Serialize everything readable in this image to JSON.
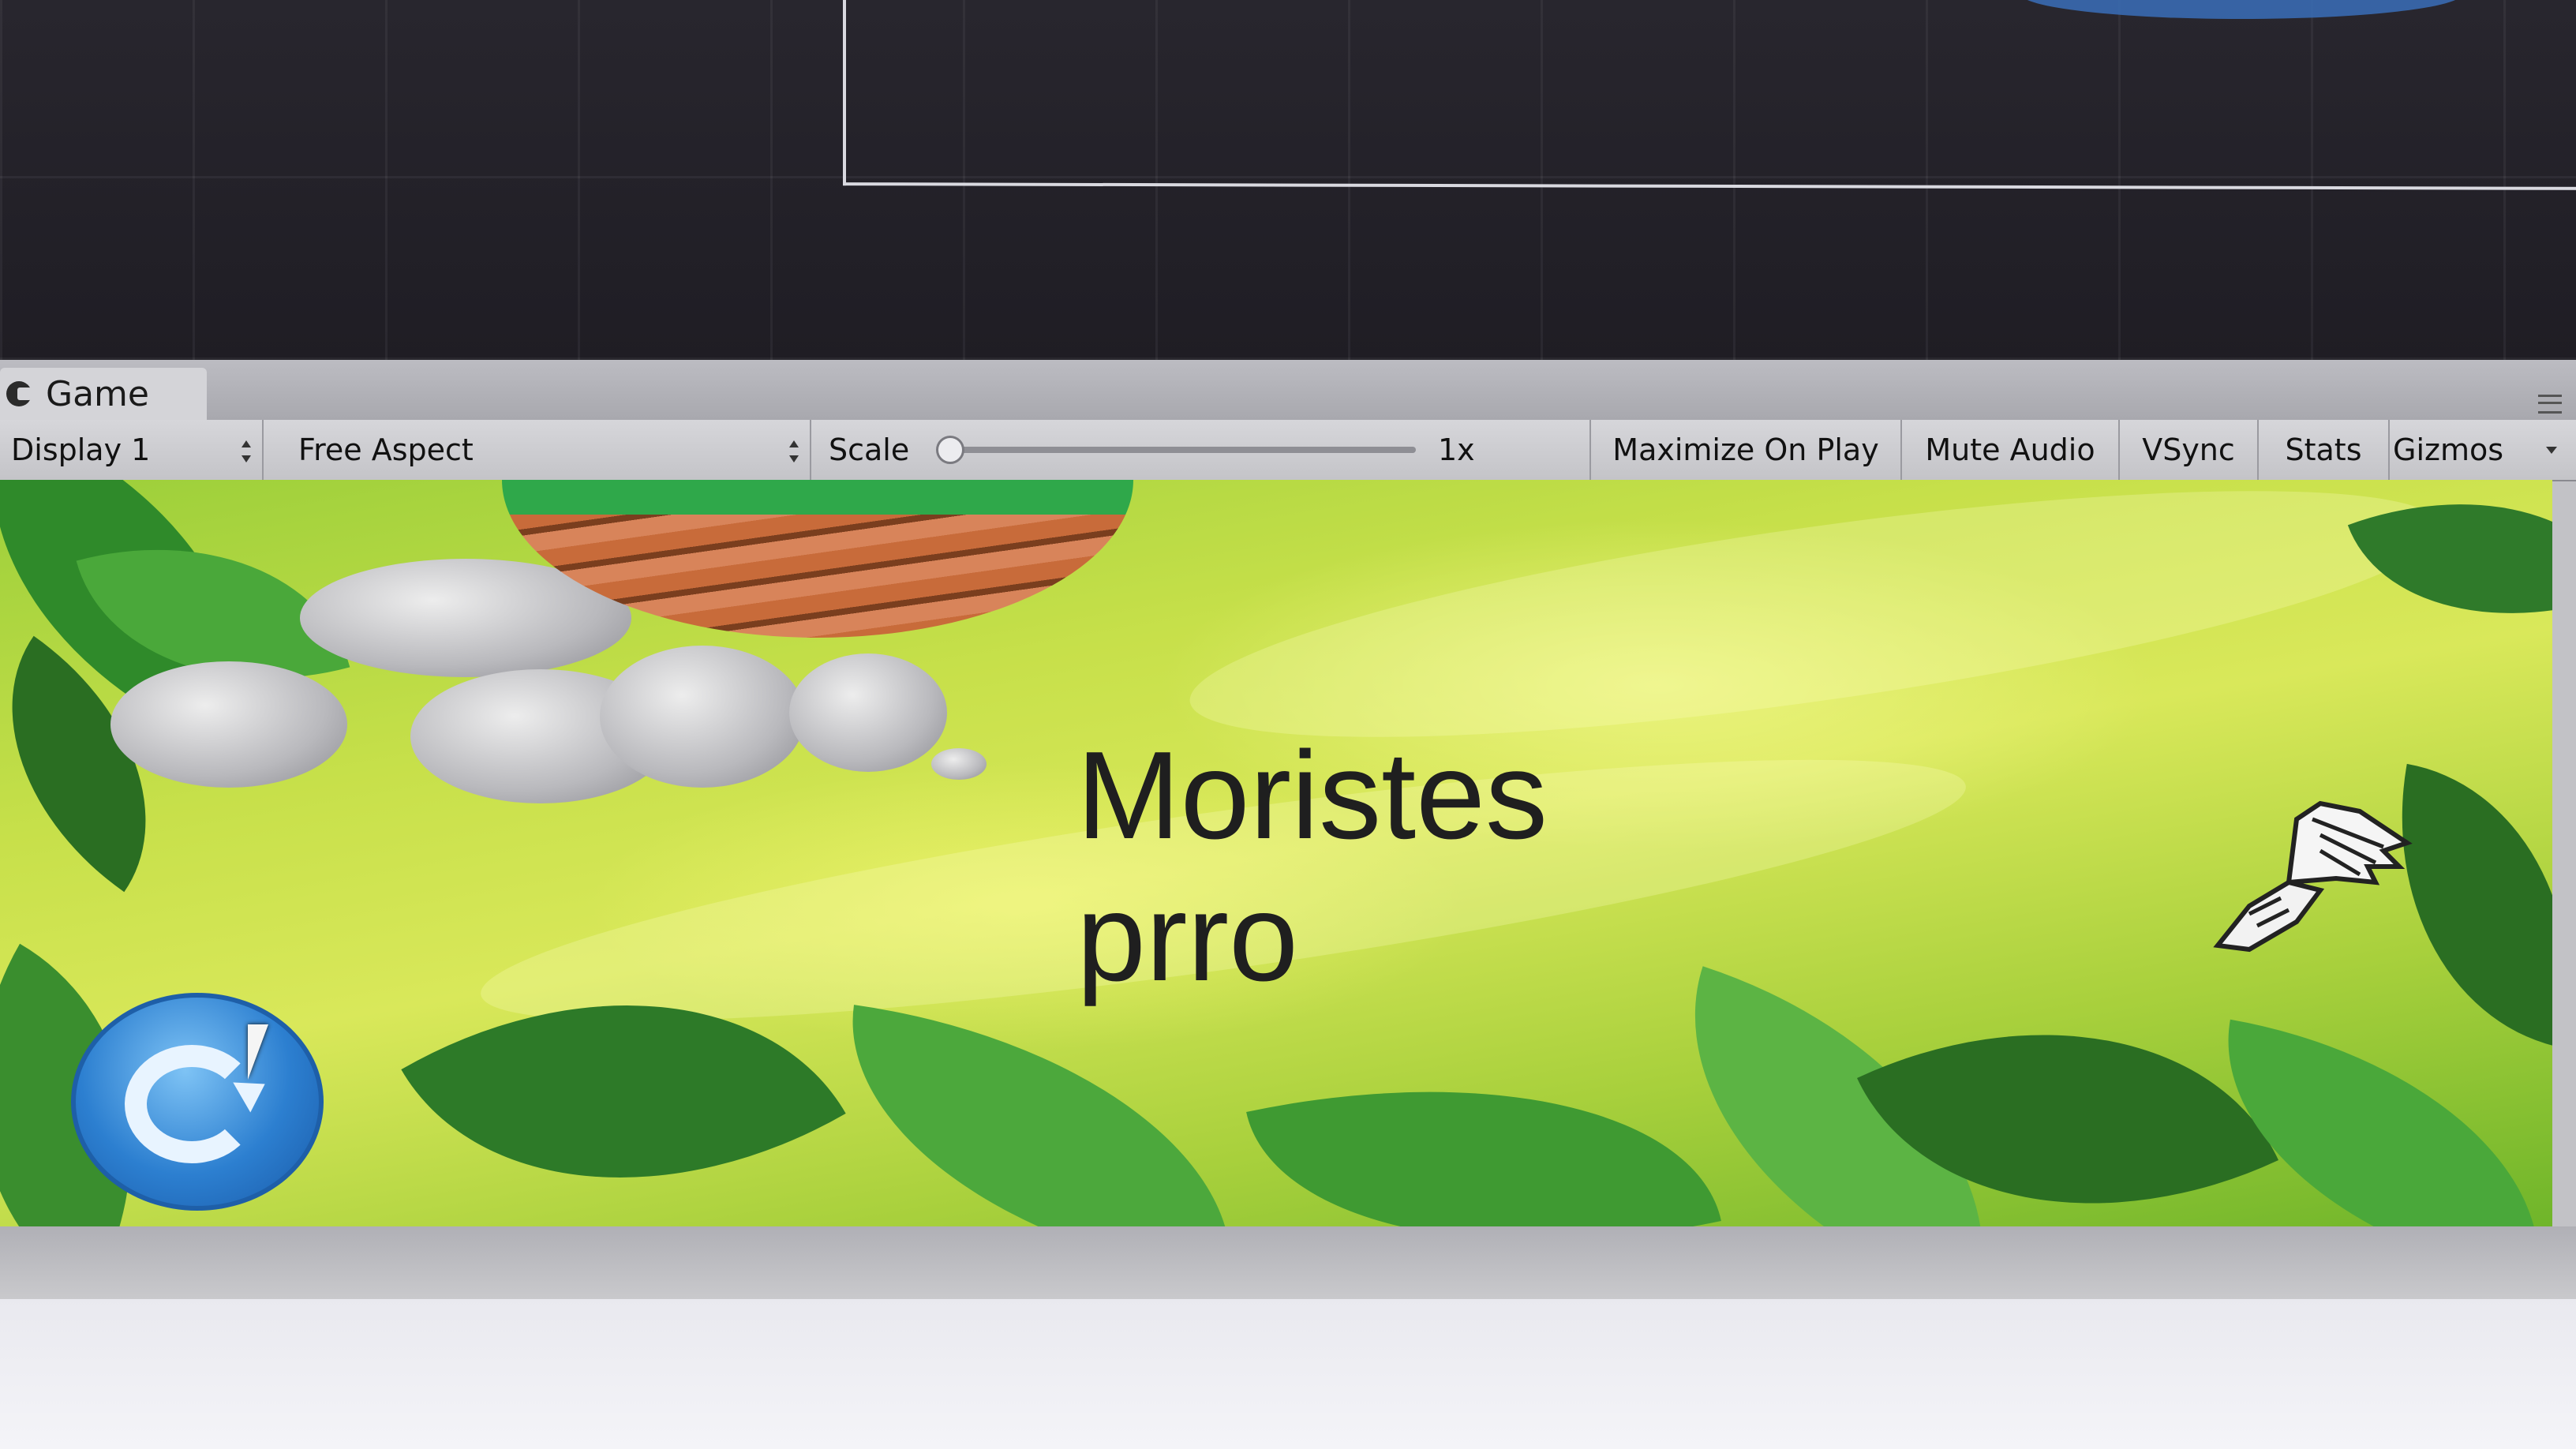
{
  "panel": {
    "tab_label": "Game"
  },
  "toolbar": {
    "display_value": "Display 1",
    "aspect_value": "Free Aspect",
    "scale_label": "Scale",
    "scale_value": "1x",
    "scale_level": 0,
    "maximize_label": "Maximize On Play",
    "mute_label": "Mute Audio",
    "vsync_label": "VSync",
    "stats_label": "Stats",
    "gizmos_label": "Gizmos"
  },
  "game": {
    "title_text": "Moristes\nprro",
    "restart_icon": "restart-icon",
    "player_icon": "winged-shoe-icon"
  },
  "colors": {
    "editor_dark": "#2a2830",
    "toolbar_bg": "#d6d6da",
    "restart_blue": "#2c7fd0",
    "jungle_green": "#6fb52a"
  }
}
